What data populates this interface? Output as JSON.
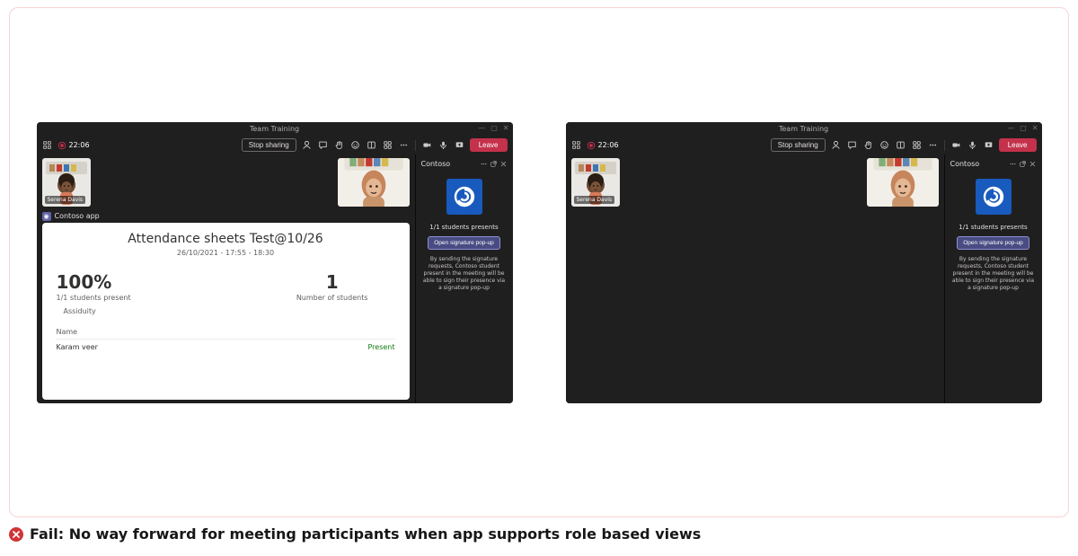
{
  "window": {
    "title": "Team Training",
    "timer": "22:06"
  },
  "toolbar": {
    "stop_sharing": "Stop sharing",
    "leave": "Leave"
  },
  "tiles": {
    "name1": "Serena Davis"
  },
  "app": {
    "tab_name": "Contoso app"
  },
  "sheet": {
    "title": "Attendance sheets Test@10/26",
    "subtitle": "26/10/2021 - 17:55 - 18:30",
    "pct": "100%",
    "pct_sub": "1/1 students present",
    "assiduity": "Assiduity",
    "num": "1",
    "num_sub": "Number of students",
    "col_name": "Name",
    "row_name": "Karam veer",
    "row_status": "Present"
  },
  "panel": {
    "title": "Contoso",
    "presents": "1/1 students presents",
    "open": "Open signature pop-up",
    "disclaimer": "By sending the signature requests, Contoso student present in the meeting will  be able to sign their presence via a signature pop-up"
  },
  "footer": {
    "text": "Fail: No way forward for meeting participants when app supports role based views"
  }
}
